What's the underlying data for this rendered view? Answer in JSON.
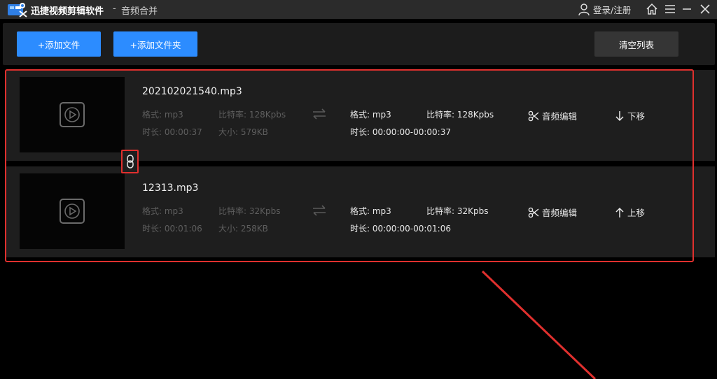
{
  "titlebar": {
    "app_name": "迅捷视频剪辑软件",
    "separator": "-",
    "subtitle": "音频合并",
    "login_label": "登录/注册",
    "icons": [
      "user-icon",
      "home-icon",
      "menu-icon",
      "minimize-icon",
      "close-icon"
    ]
  },
  "toolbar": {
    "add_file_label": "+添加文件",
    "add_folder_label": "+添加文件夹",
    "clear_list_label": "清空列表"
  },
  "files": [
    {
      "name": "202102021540.mp3",
      "src_format": "格式: mp3",
      "src_bitrate": "比特率: 128Kpbs",
      "src_duration": "时长: 00:00:37",
      "src_size": "大小: 579KB",
      "out_format": "格式: mp3",
      "out_bitrate": "比特率: 128Kpbs",
      "out_duration": "时长: 00:00:00-00:00:37",
      "edit_label": "音频编辑",
      "move_label": "下移",
      "move_icon": "arrow-down-icon"
    },
    {
      "name": "12313.mp3",
      "src_format": "格式: mp3",
      "src_bitrate": "比特率: 32Kpbs",
      "src_duration": "时长: 00:01:06",
      "src_size": "大小: 258KB",
      "out_format": "格式: mp3",
      "out_bitrate": "比特率: 32Kpbs",
      "out_duration": "时长: 00:00:00-00:01:06",
      "edit_label": "音频编辑",
      "move_label": "上移",
      "move_icon": "arrow-up-icon"
    }
  ],
  "colors": {
    "accent": "#2c8cff",
    "annotation": "#e0302e"
  }
}
